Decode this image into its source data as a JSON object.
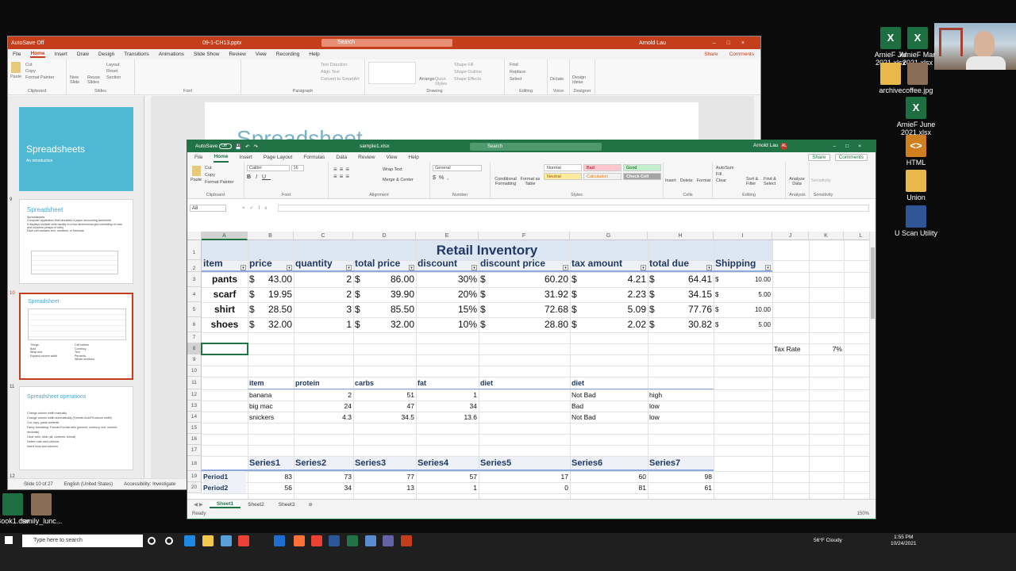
{
  "desktop": {
    "icons_right": [
      {
        "label": "ArnieF Jul 2021.xlsx",
        "kind": "xl"
      },
      {
        "label": "ArnieF Mar 2021.xlsx",
        "kind": "xl"
      },
      {
        "label": "archive",
        "kind": "folder"
      },
      {
        "label": "coffee.jpg",
        "kind": "img"
      },
      {
        "label": "ArnieF June 2021.xlsx",
        "kind": "xl"
      },
      {
        "label": "HTML",
        "kind": "html"
      },
      {
        "label": "Union",
        "kind": "folder"
      },
      {
        "label": "U Scan Utility",
        "kind": "tool"
      }
    ],
    "icons_bottom": [
      {
        "label": "Book1.csv"
      },
      {
        "label": "family_lunc..."
      }
    ]
  },
  "powerpoint": {
    "filename": "09-1-CH13.pptx",
    "autosave": "AutoSave",
    "autosave_state": "Off",
    "search_placeholder": "Search",
    "user": "Arnold Lau",
    "user_initials": "AL",
    "tabs": [
      "File",
      "Home",
      "Insert",
      "Draw",
      "Design",
      "Transitions",
      "Animations",
      "Slide Show",
      "Review",
      "View",
      "Recording",
      "Help"
    ],
    "active_tab": "Home",
    "share": "Share",
    "comments": "Comments",
    "ribbon": {
      "clipboard": {
        "label": "Clipboard",
        "paste": "Paste",
        "cut": "Cut",
        "copy": "Copy",
        "format_painter": "Format Painter"
      },
      "slides": {
        "label": "Slides",
        "new_slide": "New Slide",
        "reuse": "Reuse Slides",
        "layout": "Layout",
        "reset": "Reset",
        "section": "Section"
      },
      "font": {
        "label": "Font"
      },
      "paragraph": {
        "label": "Paragraph",
        "text_direction": "Text Direction",
        "align_text": "Align Text",
        "smartart": "Convert to SmartArt"
      },
      "drawing": {
        "label": "Drawing",
        "arrange": "Arrange",
        "quick_styles": "Quick Styles",
        "shape_fill": "Shape Fill",
        "shape_outline": "Shape Outline",
        "shape_effects": "Shape Effects"
      },
      "editing": {
        "label": "Editing",
        "find": "Find",
        "replace": "Replace",
        "select": "Select"
      },
      "voice": {
        "label": "Voice",
        "dictate": "Dictate"
      },
      "designer": {
        "label": "Designer",
        "design_ideas": "Design Ideas"
      }
    },
    "slides": [
      {
        "num": "",
        "title": "Spreadsheets",
        "subtitle": "An introduction"
      },
      {
        "num": "9",
        "title": "Spreadsheet",
        "bullets": [
          "Spreadsheets",
          "Computer application that simulates a paper accounting worksheet",
          "It displays multiple cells usually in a two-dimensional grid consisting of rows and columns (arrays of cells)",
          "Each cell contains text, numbers, or formulas"
        ]
      },
      {
        "num": "10",
        "title": "Spreadsheet",
        "bullets": [
          "Things",
          "Bold",
          "Wrap text",
          "Expand column width",
          "Cell entries",
          "Currency",
          "Text",
          "Percents",
          "Whole numbers"
        ]
      },
      {
        "num": "11",
        "title": "Spreadsheet operations",
        "bullets": [
          "Change column width manually",
          "Change column width automatically (Format>AutoFit column width)",
          "Cut, copy, paste contents",
          "Fancy formatting: Format>Format cells (percent, currency, text, number, decimals)",
          "Clear cells: clear (all, contents, format)",
          "Delete rows and columns",
          "Insert rows and columns"
        ]
      },
      {
        "num": "12",
        "title": "",
        "bullets": []
      }
    ],
    "canvas_title": "Spreadsheet",
    "status": {
      "slide": "Slide 10 of 27",
      "language": "English (United States)",
      "accessibility": "Accessibility: Investigate"
    }
  },
  "excel": {
    "autosave": "AutoSave",
    "autosave_state": "Off",
    "filename": "sample1.xlsx",
    "search_placeholder": "Search",
    "user": "Arnold Lau",
    "user_initials": "AL",
    "tabs": [
      "File",
      "Home",
      "Insert",
      "Page Layout",
      "Formulas",
      "Data",
      "Review",
      "View",
      "Help"
    ],
    "active_tab": "Home",
    "share": "Share",
    "comments": "Comments",
    "ribbon": {
      "clipboard": {
        "label": "Clipboard",
        "paste": "Paste",
        "cut": "Cut",
        "copy": "Copy",
        "format_painter": "Format Painter"
      },
      "font": {
        "label": "Font",
        "family": "Calibri",
        "size": "16"
      },
      "alignment": {
        "label": "Alignment",
        "wrap": "Wrap Text",
        "merge": "Merge & Center"
      },
      "number": {
        "label": "Number",
        "format": "General"
      },
      "styles": {
        "label": "Styles",
        "conditional": "Conditional Formatting",
        "format_table": "Format as Table",
        "normal": "Normal",
        "bad": "Bad",
        "good": "Good",
        "neutral": "Neutral",
        "calculation": "Calculation",
        "check_cell": "Check Cell"
      },
      "cells": {
        "label": "Cells",
        "insert": "Insert",
        "delete": "Delete",
        "format": "Format"
      },
      "editing": {
        "label": "Editing",
        "autosum": "AutoSum",
        "fill": "Fill",
        "clear": "Clear",
        "sort": "Sort & Filter",
        "find": "Find & Select"
      },
      "analysis": {
        "label": "Analysis",
        "analyze": "Analyze Data"
      },
      "sensitivity": {
        "label": "Sensitivity",
        "sensitivity": "Sensitivity"
      }
    },
    "name_box": "A8",
    "columns": [
      "A",
      "B",
      "C",
      "D",
      "E",
      "F",
      "G",
      "H",
      "I",
      "J",
      "K",
      "L"
    ],
    "rows": [
      "1",
      "2",
      "3",
      "4",
      "5",
      "6",
      "7",
      "8",
      "9",
      "10",
      "11",
      "12",
      "13",
      "14",
      "15",
      "16",
      "17",
      "18",
      "19",
      "20"
    ],
    "inventory": {
      "title": "Retail Inventory",
      "headers": [
        "item",
        "price",
        "quantity",
        "total price",
        "discount",
        "discount price",
        "tax amount",
        "total due",
        "Shipping"
      ],
      "rows": [
        {
          "item": "pants",
          "price": "43.00",
          "quantity": "2",
          "total": "86.00",
          "discount": "30%",
          "discount_price": "60.20",
          "tax": "4.21",
          "due": "64.41",
          "shipping": "10.00"
        },
        {
          "item": "scarf",
          "price": "19.95",
          "quantity": "2",
          "total": "39.90",
          "discount": "20%",
          "discount_price": "31.92",
          "tax": "2.23",
          "due": "34.15",
          "shipping": "5.00"
        },
        {
          "item": "shirt",
          "price": "28.50",
          "quantity": "3",
          "total": "85.50",
          "discount": "15%",
          "discount_price": "72.68",
          "tax": "5.09",
          "due": "77.76",
          "shipping": "10.00"
        },
        {
          "item": "shoes",
          "price": "32.00",
          "quantity": "1",
          "total": "32.00",
          "discount": "10%",
          "discount_price": "28.80",
          "tax": "2.02",
          "due": "30.82",
          "shipping": "5.00"
        }
      ],
      "currency": "$"
    },
    "tax_rate": {
      "label": "Tax Rate",
      "value": "7%"
    },
    "nutrition": {
      "headers": [
        "item",
        "protein",
        "carbs",
        "fat",
        "diet",
        "diet"
      ],
      "rows": [
        {
          "item": "banana",
          "protein": "2",
          "carbs": "51",
          "fat": "1",
          "diet": "Not Bad",
          "diet2": "high"
        },
        {
          "item": "big mac",
          "protein": "24",
          "carbs": "47",
          "fat": "34",
          "diet": "Bad",
          "diet2": "low"
        },
        {
          "item": "snickers",
          "protein": "4.3",
          "carbs": "34.5",
          "fat": "13.6",
          "diet": "Not Bad",
          "diet2": "low"
        }
      ]
    },
    "series": {
      "headers": [
        "Series1",
        "Series2",
        "Series3",
        "Series4",
        "Series5",
        "Series6",
        "Series7"
      ],
      "rows": [
        {
          "label": "Period1",
          "values": [
            "83",
            "73",
            "77",
            "57",
            "17",
            "60",
            "98"
          ]
        },
        {
          "label": "Period2",
          "values": [
            "56",
            "34",
            "13",
            "1",
            "0",
            "81",
            "61"
          ]
        }
      ]
    },
    "sheets": [
      "Sheet1",
      "Sheet2",
      "Sheet3"
    ],
    "active_sheet": "Sheet1",
    "status": {
      "ready": "Ready",
      "zoom": "150%"
    }
  },
  "taskbar": {
    "search_placeholder": "Type here to search",
    "weather": "56°F Cloudy",
    "time": "1:55 PM",
    "date": "10/24/2021"
  },
  "colors": {
    "excel_green": "#217346",
    "ppt_orange": "#c43e1c",
    "header_blue": "#1f3864",
    "table_band": "#eef2f8"
  }
}
